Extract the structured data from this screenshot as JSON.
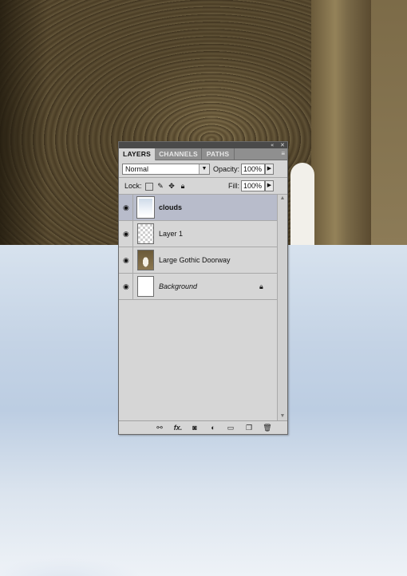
{
  "panel": {
    "tabs": [
      {
        "label": "LAYERS",
        "active": true
      },
      {
        "label": "CHANNELS",
        "active": false
      },
      {
        "label": "PATHS",
        "active": false
      }
    ],
    "titlebar_icons": {
      "collapse": "«",
      "close": "✕"
    },
    "menu_icon": "≡",
    "blend_mode": "Normal",
    "opacity_label": "Opacity:",
    "opacity_value": "100%",
    "lock_label": "Lock:",
    "fill_label": "Fill:",
    "fill_value": "100%",
    "lock_icons": [
      "lock-transparent-pixels-icon",
      "lock-image-pixels-icon",
      "lock-position-icon",
      "lock-all-icon"
    ],
    "layers": [
      {
        "name": "clouds",
        "visible": true,
        "selected": true,
        "thumb": "clouds",
        "style": "bold"
      },
      {
        "name": "Layer 1",
        "visible": true,
        "selected": false,
        "thumb": "transparent",
        "style": "normal"
      },
      {
        "name": "Large Gothic Doorway",
        "visible": true,
        "selected": false,
        "thumb": "doorway",
        "style": "normal"
      },
      {
        "name": "Background",
        "visible": true,
        "selected": false,
        "thumb": "white",
        "style": "italic",
        "locked": true
      }
    ],
    "bottom_icons": [
      "link-layers-icon",
      "layer-style-icon",
      "layer-mask-icon",
      "adjustment-layer-icon",
      "new-group-icon",
      "new-layer-icon",
      "delete-layer-icon"
    ],
    "fx_label": "fx."
  }
}
